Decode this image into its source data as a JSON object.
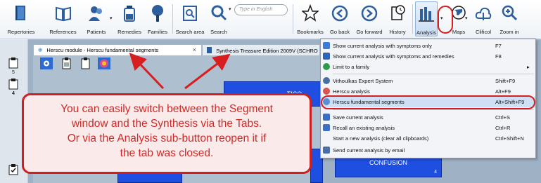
{
  "toolbar": {
    "buttons": [
      {
        "label": "Repertories",
        "icon": "repertory-book-icon"
      },
      {
        "label": "References",
        "icon": "open-book-icon"
      },
      {
        "label": "Patients",
        "icon": "patients-icon"
      },
      {
        "label": "Remedies",
        "icon": "remedy-bottle-icon"
      },
      {
        "label": "Families",
        "icon": "family-tree-icon"
      },
      {
        "label": "Search area",
        "icon": "search-area-icon"
      },
      {
        "label": "Search",
        "icon": "magnifier-icon"
      },
      {
        "label": "Bookmarks",
        "icon": "star-icon"
      },
      {
        "label": "Go back",
        "icon": "back-arrow-icon"
      },
      {
        "label": "Go forward",
        "icon": "forward-arrow-icon"
      },
      {
        "label": "History",
        "icon": "history-icon"
      },
      {
        "label": "Analysis",
        "icon": "bar-chart-icon"
      },
      {
        "label": "Maps",
        "icon": "globe-icon"
      },
      {
        "label": "Clificol",
        "icon": "cloud-icon"
      },
      {
        "label": "Zoom in",
        "icon": "zoom-in-icon"
      }
    ],
    "search_placeholder": "Type in English"
  },
  "left_strip": {
    "items": [
      {
        "value": "5"
      },
      {
        "value": "4"
      }
    ]
  },
  "tabs": [
    {
      "label": "Herscu module - Herscu fundamental segments",
      "close": "×"
    },
    {
      "label": "Synthesis Treasure Edition 2009V (SCHRO"
    }
  ],
  "segments": {
    "box_top_label": "TICO",
    "box_bottom_label": "CONFUSION",
    "box_bottom_count": "4"
  },
  "callout": {
    "lines": [
      "You can easily switch between the Segment",
      "window and the Synthesis via the Tabs.",
      "Or via the Analysis sub-button reopen it if",
      "the tab was closed."
    ]
  },
  "analysis_menu": {
    "items": [
      {
        "label": "Show current analysis with symptoms only",
        "shortcut": "F7",
        "icon_color": "#3a7bd5"
      },
      {
        "label": "Show current analysis with symptoms and remedies",
        "shortcut": "F8",
        "icon_color": "#2e64b8"
      },
      {
        "label": "Limit to a family",
        "shortcut": "",
        "icon_color": "#2f9a4c",
        "submenu": "▸"
      },
      {
        "label": "Vithoulkas Expert System",
        "shortcut": "Shift+F9",
        "icon_color": "#4a6fa5"
      },
      {
        "label": "Herscu analysis",
        "shortcut": "Alt+F9",
        "icon_color": "#d9534f"
      },
      {
        "label": "Herscu fundamental segments",
        "shortcut": "Alt+Shift+F9",
        "icon_color": "#5a8fd8"
      },
      {
        "label": "Save current analysis",
        "shortcut": "Ctrl+S",
        "icon_color": "#3b6fc4"
      },
      {
        "label": "Recall an existing analysis",
        "shortcut": "Ctrl+R",
        "icon_color": "#3b6fc4"
      },
      {
        "label": "Start a new analysis (clear all clipboards)",
        "shortcut": "Ctrl+Shift+N",
        "icon_color": ""
      },
      {
        "label": "Send current analysis by email",
        "shortcut": "",
        "icon_color": "#4a6fa5"
      }
    ]
  },
  "colors": {
    "annotation_red": "#d81e1e",
    "callout_text": "#cf2a27",
    "segment_box": "#1f4fe0",
    "menu_highlight": "#cfe0f4"
  }
}
